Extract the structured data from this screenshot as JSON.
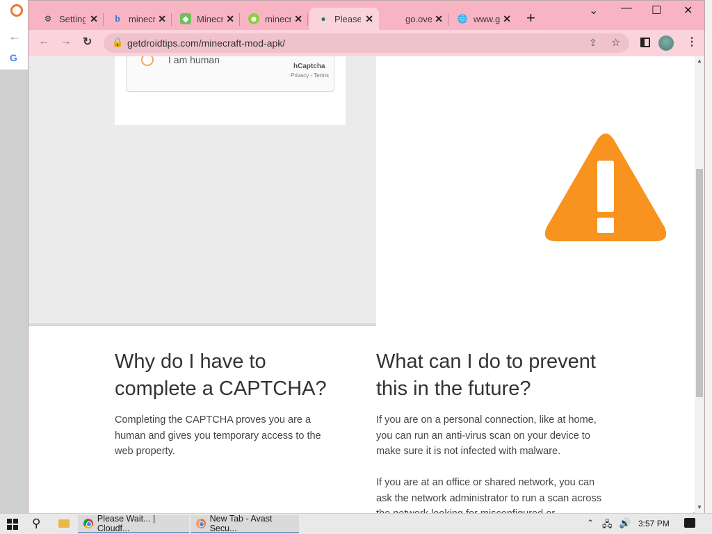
{
  "window": {
    "tabs": [
      {
        "label": "Settings",
        "icon": "gear-icon"
      },
      {
        "label": "minecraft",
        "icon": "bing-icon"
      },
      {
        "label": "Minecraft",
        "icon": "app-icon"
      },
      {
        "label": "minecraft",
        "icon": "face-icon"
      },
      {
        "label": "Please",
        "icon": "cloudflare-icon"
      },
      {
        "label": "go.overheid",
        "icon": "blank-icon"
      },
      {
        "label": "www.g",
        "icon": "globe-icon"
      }
    ],
    "new_tab": "+",
    "controls": {
      "minimize": "⌄",
      "min": "—",
      "max": "☐",
      "close": "✕"
    }
  },
  "toolbar": {
    "url": "getdroidtips.com/minecraft-mod-apk/"
  },
  "captcha": {
    "label": "I am human",
    "brand": "hCaptcha",
    "links": "Privacy - Terms"
  },
  "content": {
    "left_heading": "Why do I have to complete a CAPTCHA?",
    "left_paragraph": "Completing the CAPTCHA proves you are a human and gives you temporary access to the web property.",
    "right_heading": "What can I do to prevent this in the future?",
    "right_paragraph_1": "If you are on a personal connection, like at home, you can run an anti-virus scan on your device to make sure it is not infected with malware.",
    "right_paragraph_2": "If you are at an office or shared network, you can ask the network administrator to run a scan across the network looking for misconfigured or"
  },
  "taskbar": {
    "items": [
      {
        "label": "Please Wait... | Cloudf..."
      },
      {
        "label": "New Tab - Avast Secu..."
      }
    ],
    "time": "3:57 PM"
  },
  "colors": {
    "accent_pink": "#f9b4c3",
    "warning_orange": "#f7931e"
  }
}
